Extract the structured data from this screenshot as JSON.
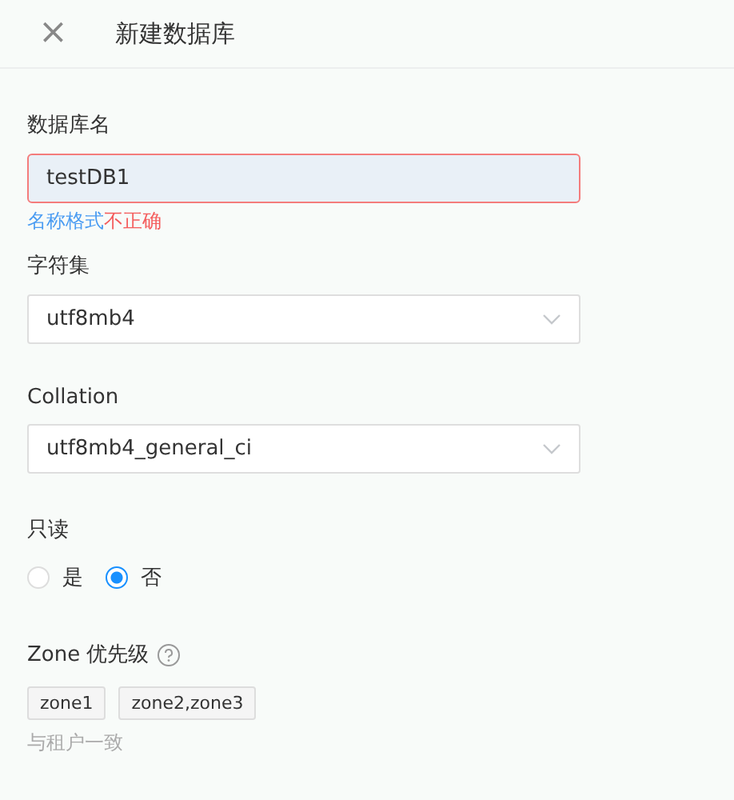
{
  "header": {
    "close": "×",
    "title": "新建数据库"
  },
  "name_field": {
    "label": "数据库名",
    "value": "testDB1",
    "invalid": true,
    "error": {
      "lead": "名称格式",
      "rest": "不正确"
    }
  },
  "charset": {
    "label": "字符集",
    "value": "utf8mb4"
  },
  "collation": {
    "label": "Collation",
    "value": "utf8mb4_general_ci"
  },
  "readonly": {
    "label": "只读",
    "options": [
      {
        "label": "是",
        "selected": false
      },
      {
        "label": "否",
        "selected": true
      }
    ]
  },
  "zone": {
    "label": "Zone 优先级",
    "tags": [
      "zone1",
      "zone2,zone3"
    ],
    "note": "与租户一致"
  }
}
